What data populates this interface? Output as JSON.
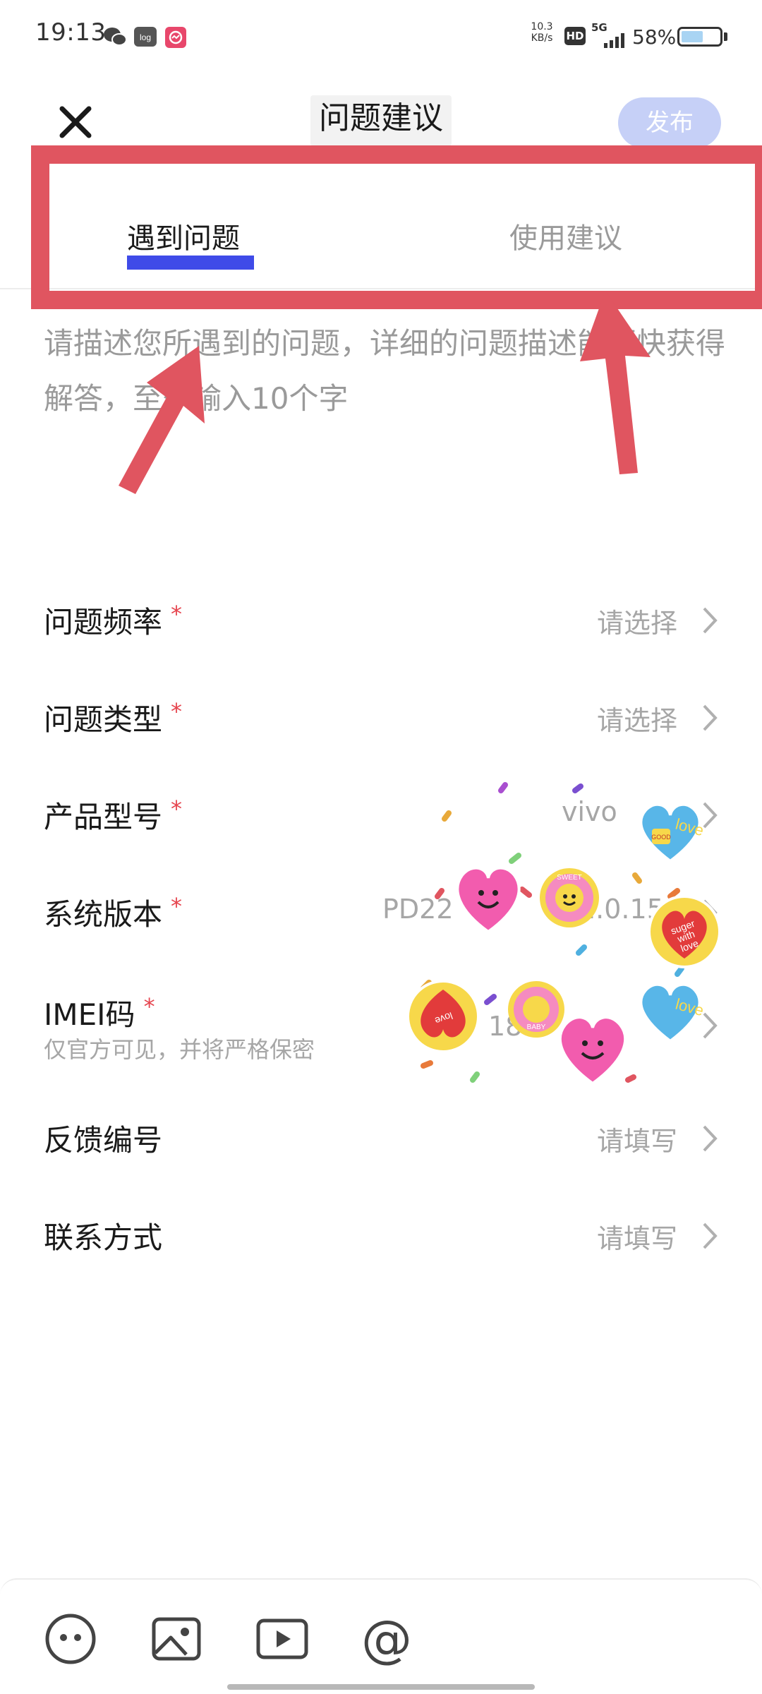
{
  "status_bar": {
    "time": "19:13",
    "net_speed_value": "10.3",
    "net_speed_unit": "KB/s",
    "hd_label": "HD",
    "network_label": "5G",
    "battery": "58%",
    "battery_level": 0.58,
    "app_icons": [
      "wechat-icon",
      "log-icon",
      "app-icon"
    ]
  },
  "header": {
    "title": "问题建议",
    "publish_label": "发布"
  },
  "tabs": [
    {
      "label": "遇到问题",
      "active": true
    },
    {
      "label": "使用建议",
      "active": false
    }
  ],
  "description_placeholder": "请描述您所遇到的问题，详细的问题描述能更快获得解答，至少输入10个字",
  "form": {
    "rows": [
      {
        "label": "问题频率",
        "required": "*",
        "value": "请选择"
      },
      {
        "label": "问题类型",
        "required": "*",
        "value": "请选择"
      },
      {
        "label": "产品型号",
        "required": "*",
        "value": "vivo"
      },
      {
        "label": "系统版本",
        "required": "*",
        "value": "PD22",
        "value2": "2.0.15"
      },
      {
        "label": "IMEI码",
        "required": "*",
        "value": "18",
        "note": "仅官方可见，并将严格保密"
      },
      {
        "label": "反馈编号",
        "required": "",
        "value": "请填写"
      },
      {
        "label": "联系方式",
        "required": "",
        "value": "请填写"
      }
    ]
  },
  "sticker_text": {
    "love": "love",
    "good": "GOOD",
    "suger": "suger",
    "with": "with",
    "sweet": "SWEET",
    "baby": "BABY"
  },
  "toolbar": {
    "icons": [
      "emoji-icon",
      "image-icon",
      "video-icon",
      "at-icon"
    ],
    "at_glyph": "@"
  },
  "colors": {
    "accent": "#3f4be8",
    "publish_bg": "#c6d0f7",
    "annotation_red": "#e05560",
    "required_red": "#e6454f"
  }
}
